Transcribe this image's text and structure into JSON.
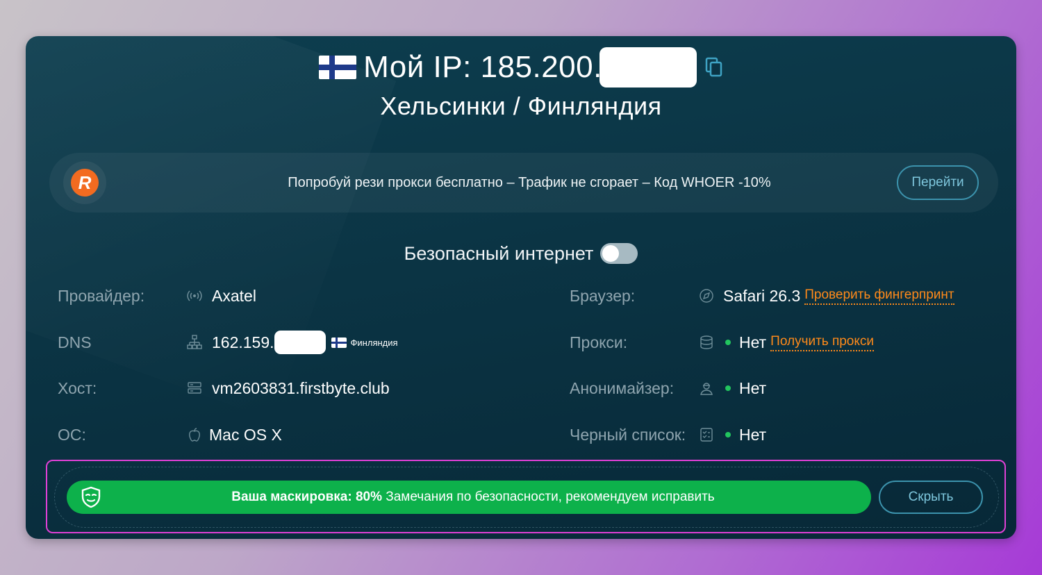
{
  "header": {
    "ip_label": "Мой IP:",
    "ip_value": "185.200.",
    "location": "Хельсинки / Финляндия"
  },
  "promo": {
    "logo_letter": "R",
    "text": "Попробуй рези прокси бесплатно – Трафик не сгорает – Код WHOER -10%",
    "button_label": "Перейти"
  },
  "safe_internet": {
    "label": "Безопасный интернет",
    "enabled": false
  },
  "left_info": {
    "provider": {
      "label": "Провайдер:",
      "value": "Axatel",
      "icon": "signal-icon"
    },
    "dns": {
      "label": "DNS",
      "value": "162.159.",
      "country": "Финляндия",
      "icon": "network-icon"
    },
    "host": {
      "label": "Хост:",
      "value": "vm2603831.firstbyte.club",
      "icon": "server-icon"
    },
    "os": {
      "label": "ОС:",
      "value": "Mac OS X",
      "icon": "apple-icon"
    }
  },
  "right_info": {
    "browser": {
      "label": "Браузер:",
      "value": "Safari 26.3",
      "link": "Проверить фингерпринт",
      "icon": "compass-icon"
    },
    "proxy": {
      "label": "Прокси:",
      "value": "Нет",
      "link": "Получить прокси",
      "icon": "database-icon"
    },
    "anonymizer": {
      "label": "Анонимайзер:",
      "value": "Нет",
      "icon": "user-icon"
    },
    "blacklist": {
      "label": "Черный список:",
      "value": "Нет",
      "icon": "list-icon"
    }
  },
  "disguise": {
    "bold_label": "Ваша маскировка: 80%",
    "message": "Замечания по безопасности, рекомендуем исправить",
    "hide_button": "Скрыть"
  },
  "colors": {
    "card_bg": "#0b3444",
    "accent_orange": "#ff8a1a",
    "status_green": "#22c55e",
    "disguise_green": "#0db14b",
    "highlight": "#e040d6"
  }
}
